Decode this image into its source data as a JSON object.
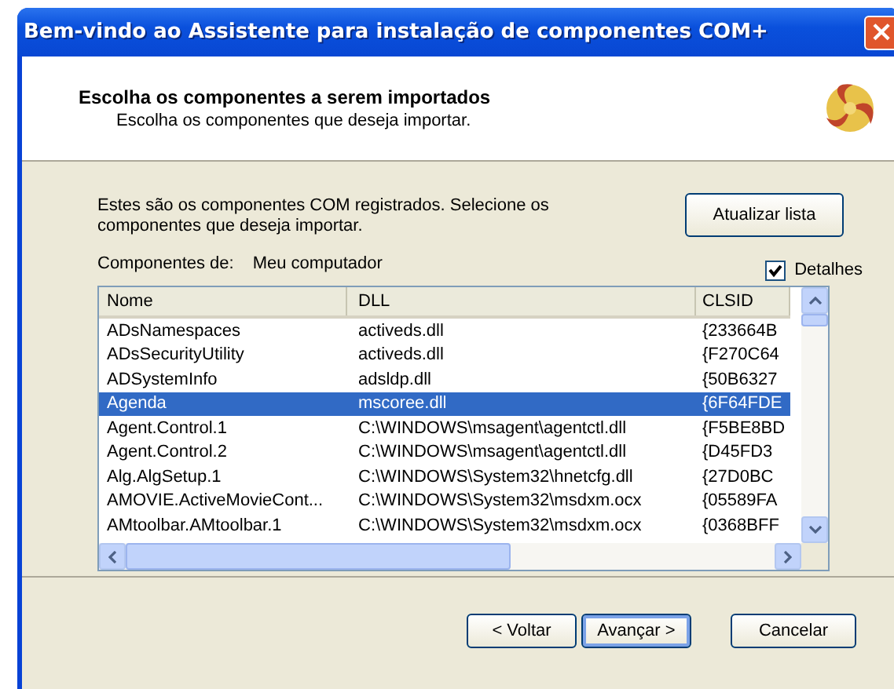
{
  "window": {
    "title": "Bem-vindo ao Assistente para instalação de componentes COM+",
    "close": "×"
  },
  "header": {
    "title": "Escolha os componentes a serem importados",
    "subtitle": "Escolha os componentes que deseja importar."
  },
  "intro": "Estes são os componentes COM registrados. Selecione os componentes que deseja importar.",
  "refresh_button": "Atualizar lista",
  "source": {
    "label": "Componentes de:",
    "value": "Meu computador"
  },
  "details": {
    "label": "Detalhes",
    "checked": true
  },
  "table": {
    "columns": [
      "Nome",
      "DLL",
      "CLSID"
    ],
    "rows": [
      {
        "cells": [
          "ADsNamespaces",
          "activeds.dll",
          "{233664B"
        ],
        "selected": false
      },
      {
        "cells": [
          "ADsSecurityUtility",
          "activeds.dll",
          "{F270C64"
        ],
        "selected": false
      },
      {
        "cells": [
          "ADSystemInfo",
          "adsldp.dll",
          "{50B6327"
        ],
        "selected": false
      },
      {
        "cells": [
          "Agenda",
          "mscoree.dll",
          "{6F64FDE"
        ],
        "selected": true
      },
      {
        "cells": [
          "Agent.Control.1",
          "C:\\WINDOWS\\msagent\\agentctl.dll",
          "{F5BE8BD"
        ],
        "selected": false
      },
      {
        "cells": [
          "Agent.Control.2",
          "C:\\WINDOWS\\msagent\\agentctl.dll",
          "{D45FD3"
        ],
        "selected": false
      },
      {
        "cells": [
          "Alg.AlgSetup.1",
          "C:\\WINDOWS\\System32\\hnetcfg.dll",
          "{27D0BC"
        ],
        "selected": false
      },
      {
        "cells": [
          "AMOVIE.ActiveMovieCont...",
          "C:\\WINDOWS\\System32\\msdxm.ocx",
          "{05589FA"
        ],
        "selected": false
      },
      {
        "cells": [
          "AMtoolbar.AMtoolbar.1",
          "C:\\WINDOWS\\System32\\msdxm.ocx",
          "{0368BFF"
        ],
        "selected": false
      }
    ]
  },
  "buttons": [
    {
      "label": "< Voltar",
      "default": false
    },
    {
      "label": "Avançar >",
      "default": true
    },
    {
      "label": "Cancelar",
      "default": false
    }
  ]
}
